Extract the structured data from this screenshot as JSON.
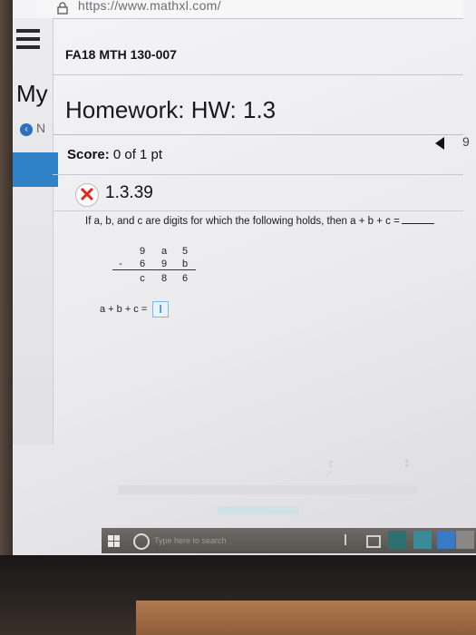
{
  "browser": {
    "url": "https://www.mathxl.com/"
  },
  "sidebar": {
    "heading_fragment": "My",
    "back_fragment": "N"
  },
  "course": {
    "title": "FA18 MTH 130-007"
  },
  "homework": {
    "title": "Homework: HW: 1.3",
    "page_number": "9"
  },
  "score": {
    "label": "Score:",
    "value": "0 of 1 pt"
  },
  "problem": {
    "id": "1.3.39",
    "status": "incorrect",
    "question": "If a, b, and c are digits for which the following holds, then a + b + c =",
    "subtraction": {
      "minuend": [
        "9",
        "a",
        "5"
      ],
      "subtrahend": [
        "6",
        "9",
        "b"
      ],
      "operator": "-",
      "difference": [
        "c",
        "8",
        "6"
      ]
    },
    "answer_label": "a + b + c =",
    "answer_value": "I"
  },
  "colors": {
    "accent_blue": "#2f82c8",
    "incorrect_red": "#e0261d",
    "answer_box_border": "#7fb6ea"
  },
  "taskbar": {
    "search_hint": "Type here to search"
  }
}
